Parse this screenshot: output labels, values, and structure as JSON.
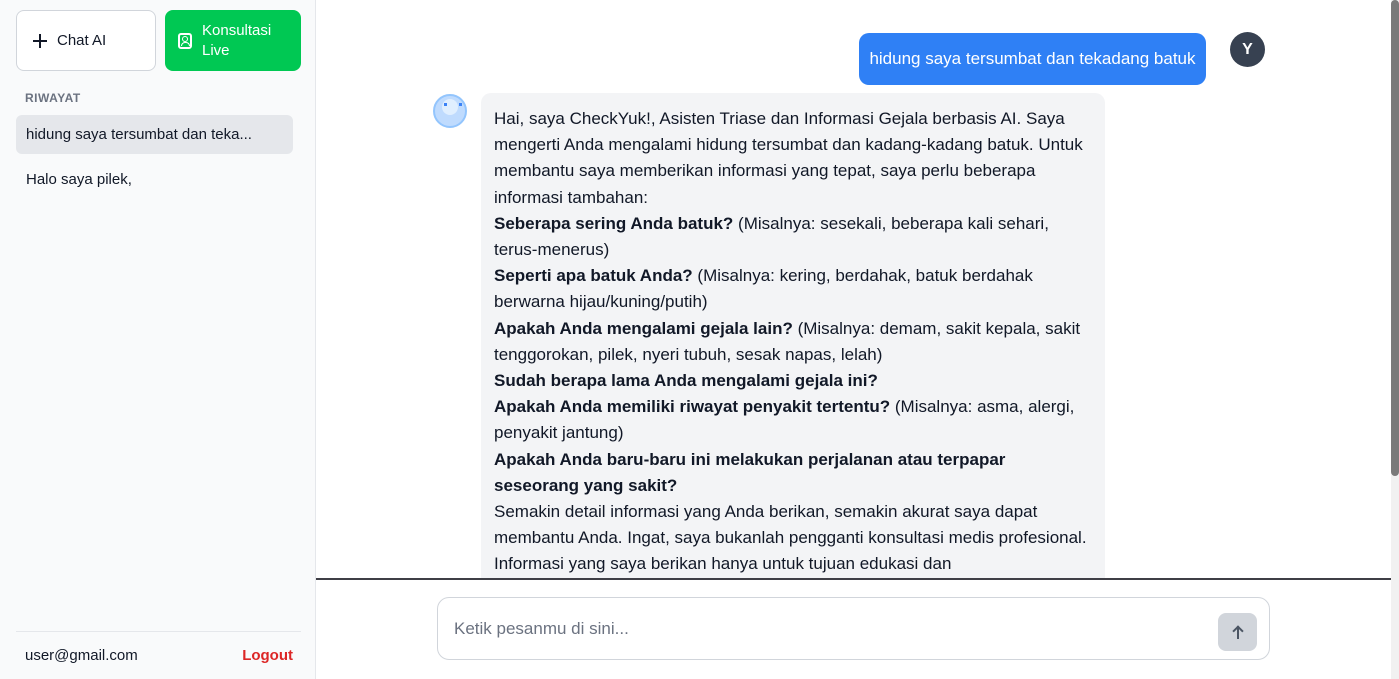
{
  "sidebar": {
    "chat_button_label": "Chat AI",
    "live_button_label": "Konsultasi Live",
    "section_title": "RIWAYAT",
    "history": [
      {
        "label": "hidung saya tersumbat dan teka..."
      },
      {
        "label": "Halo saya pilek,"
      }
    ],
    "user_email": "user@gmail.com",
    "logout_label": "Logout"
  },
  "chat": {
    "user_message": "hidung saya tersumbat dan tekadang batuk",
    "user_avatar_initial": "Y",
    "bot_message": {
      "intro": "Hai, saya CheckYuk!, Asisten Triase dan Informasi Gejala berbasis AI. Saya mengerti Anda mengalami hidung tersumbat dan kadang-kadang batuk. Untuk membantu saya memberikan informasi yang tepat, saya perlu beberapa informasi tambahan:",
      "q1_bold": "Seberapa sering Anda batuk?",
      "q1_rest": " (Misalnya: sesekali, beberapa kali sehari, terus-menerus)",
      "q2_bold": "Seperti apa batuk Anda?",
      "q2_rest": " (Misalnya: kering, berdahak, batuk berdahak berwarna hijau/kuning/putih)",
      "q3_bold": "Apakah Anda mengalami gejala lain?",
      "q3_rest": " (Misalnya: demam, sakit kepala, sakit tenggorokan, pilek, nyeri tubuh, sesak napas, lelah)",
      "q4_bold": "Sudah berapa lama Anda mengalami gejala ini?",
      "q5_bold": "Apakah Anda memiliki riwayat penyakit tertentu?",
      "q5_rest": " (Misalnya: asma, alergi, penyakit jantung)",
      "q6_bold": "Apakah Anda baru-baru ini melakukan perjalanan atau terpapar seseorang yang sakit?",
      "closing": "Semakin detail informasi yang Anda berikan, semakin akurat saya dapat membantu Anda. Ingat, saya bukanlah pengganti konsultasi medis profesional. Informasi yang saya berikan hanya untuk tujuan edukasi dan"
    }
  },
  "input": {
    "placeholder": "Ketik pesanmu di sini..."
  },
  "colors": {
    "accent_green": "#00c853",
    "user_bubble": "#2f80f5",
    "logout_red": "#dc2626"
  }
}
